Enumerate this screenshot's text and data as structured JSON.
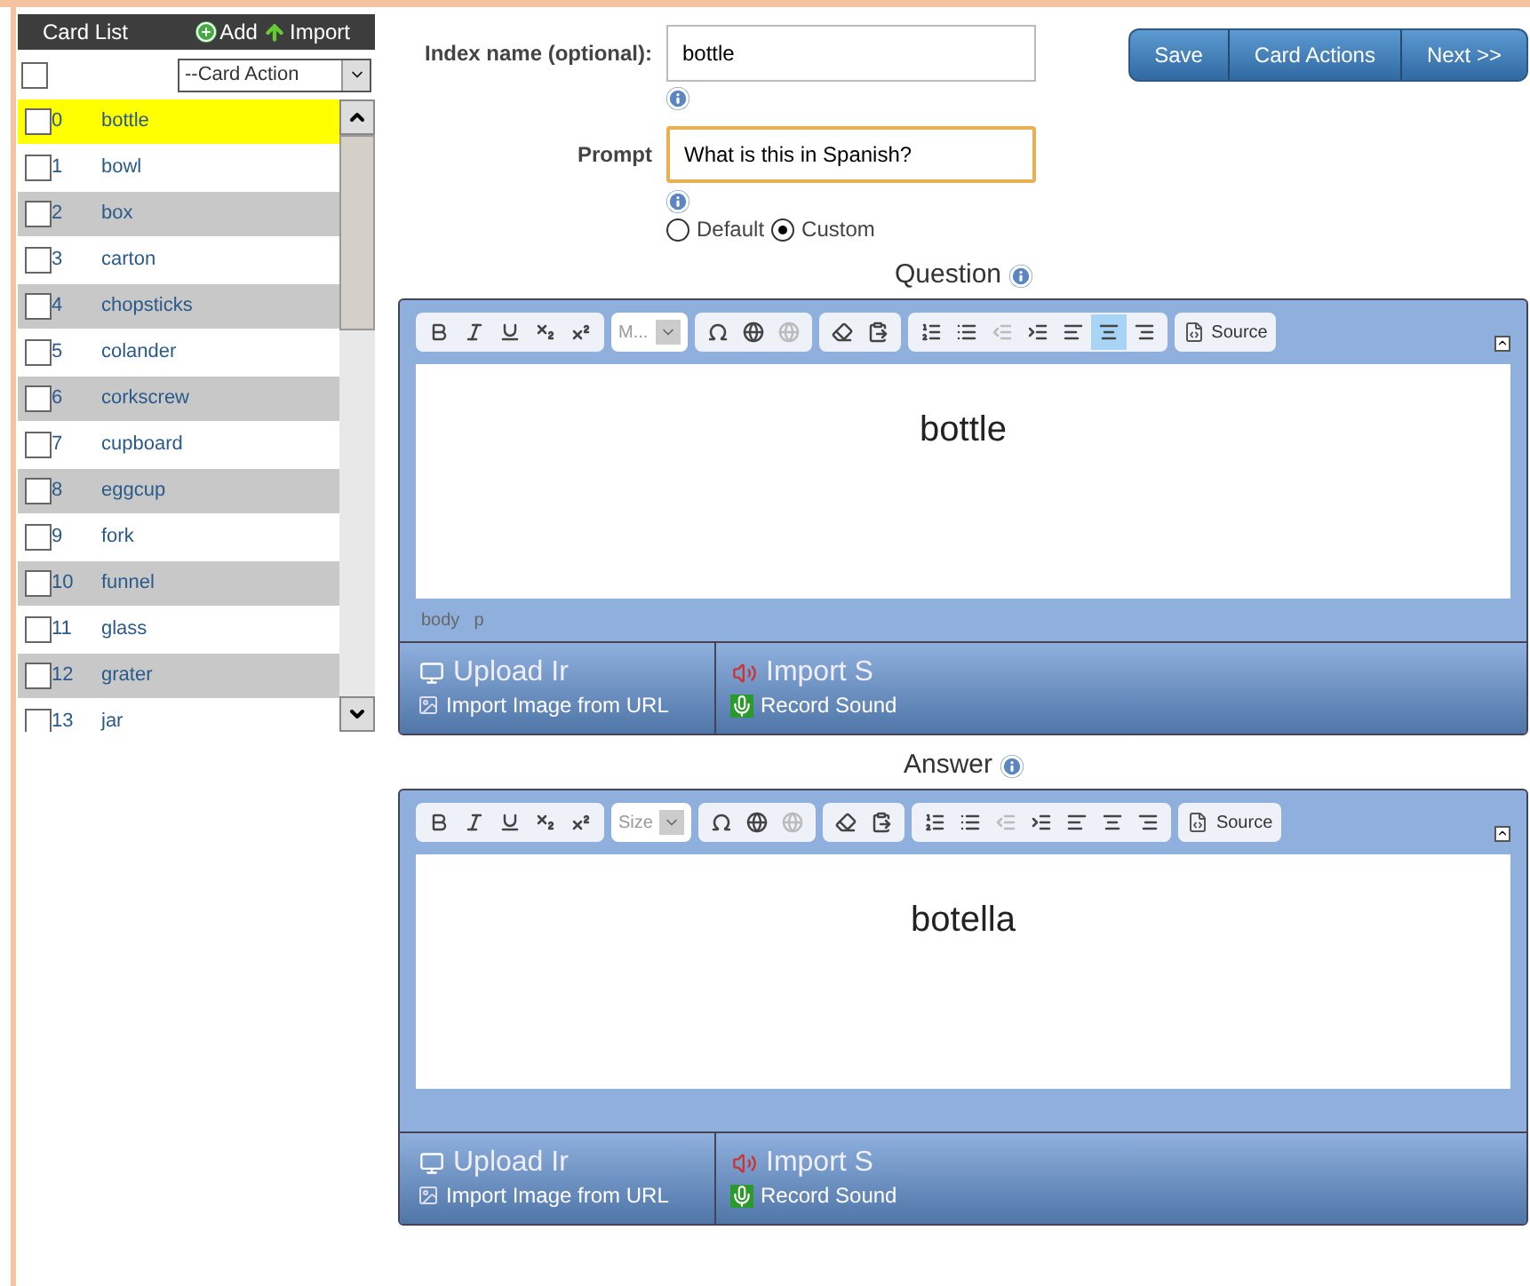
{
  "card_list": {
    "title": "Card List",
    "add": "Add",
    "import": "Import",
    "select_all_checked": false,
    "actions_placeholder": "--Card Action",
    "cards": [
      {
        "index": "0",
        "name": "bottle",
        "selected": true,
        "checked": false
      },
      {
        "index": "1",
        "name": "bowl",
        "selected": false,
        "checked": false
      },
      {
        "index": "2",
        "name": "box",
        "selected": false,
        "checked": false
      },
      {
        "index": "3",
        "name": "carton",
        "selected": false,
        "checked": false
      },
      {
        "index": "4",
        "name": "chopsticks",
        "selected": false,
        "checked": false
      },
      {
        "index": "5",
        "name": "colander",
        "selected": false,
        "checked": false
      },
      {
        "index": "6",
        "name": "corkscrew",
        "selected": false,
        "checked": false
      },
      {
        "index": "7",
        "name": "cupboard",
        "selected": false,
        "checked": false
      },
      {
        "index": "8",
        "name": "eggcup",
        "selected": false,
        "checked": false
      },
      {
        "index": "9",
        "name": "fork",
        "selected": false,
        "checked": false
      },
      {
        "index": "10",
        "name": "funnel",
        "selected": false,
        "checked": false
      },
      {
        "index": "11",
        "name": "glass",
        "selected": false,
        "checked": false
      },
      {
        "index": "12",
        "name": "grater",
        "selected": false,
        "checked": false
      },
      {
        "index": "13",
        "name": "jar",
        "selected": false,
        "checked": false
      }
    ]
  },
  "form": {
    "index_label": "Index name (optional):",
    "index_value": "bottle",
    "prompt_label": "Prompt",
    "prompt_value": "What is this in Spanish?",
    "prompt_options": [
      {
        "label": "Default",
        "selected": false
      },
      {
        "label": "Custom",
        "selected": true
      }
    ]
  },
  "buttons": [
    "Save",
    "Card Actions",
    "Next >>"
  ],
  "editors": [
    {
      "title": "Question",
      "size_control": "M...",
      "content": "bottle",
      "center_aligned": true,
      "path": [
        "body",
        "p"
      ],
      "upload_image": "Upload Ir",
      "import_sound": "Import S",
      "import_url": "Import Image from URL",
      "record_sound": "Record Sound",
      "source": "Source"
    },
    {
      "title": "Answer",
      "size_control": "Size",
      "content": "botella",
      "center_aligned": false,
      "upload_image": "Upload Ir",
      "import_sound": "Import S",
      "import_url": "Import Image from URL",
      "record_sound": "Record Sound",
      "source": "Source"
    }
  ]
}
